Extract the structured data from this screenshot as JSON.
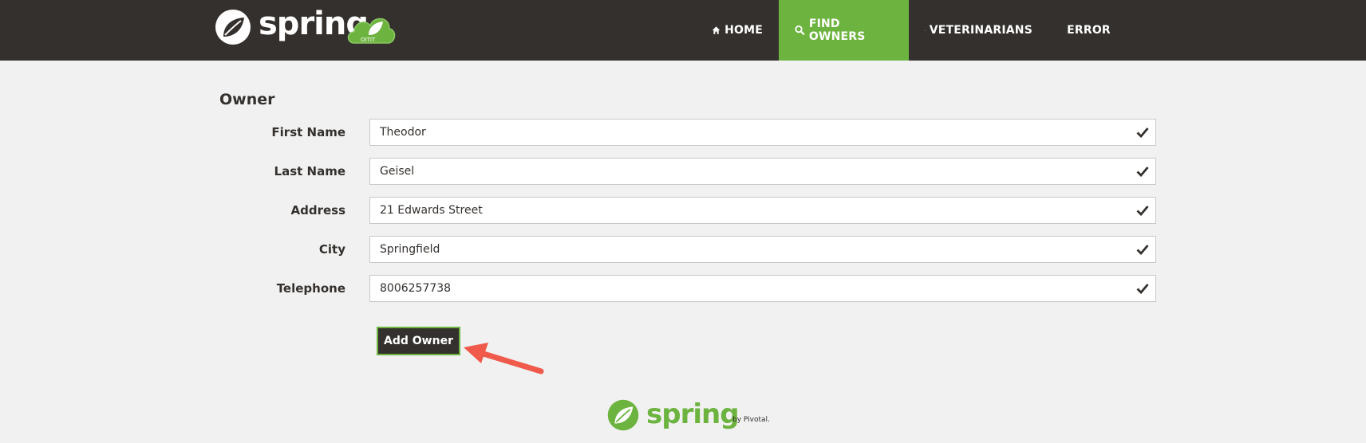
{
  "brand": {
    "name": "spring",
    "badge_text": "OITIT"
  },
  "nav": {
    "items": [
      {
        "label": "HOME",
        "icon": "home-icon"
      },
      {
        "label": "FIND OWNERS",
        "icon": "search-icon",
        "active": true
      },
      {
        "label": "VETERINARIANS",
        "icon": "list-icon"
      },
      {
        "label": "ERROR",
        "icon": "warning-icon"
      }
    ]
  },
  "form": {
    "heading": "Owner",
    "fields": [
      {
        "label": "First Name",
        "value": "Theodor"
      },
      {
        "label": "Last Name",
        "value": "Geisel"
      },
      {
        "label": "Address",
        "value": "21 Edwards Street"
      },
      {
        "label": "City",
        "value": "Springfield"
      },
      {
        "label": "Telephone",
        "value": "8006257738"
      }
    ],
    "submit_label": "Add Owner"
  },
  "footer": {
    "brand": "spring",
    "by": "by Pivotal."
  },
  "colors": {
    "brand_green": "#6db33f",
    "navbar_bg": "#34302d",
    "page_bg": "#f1f1f1",
    "annotation_arrow": "#f05a4a"
  }
}
